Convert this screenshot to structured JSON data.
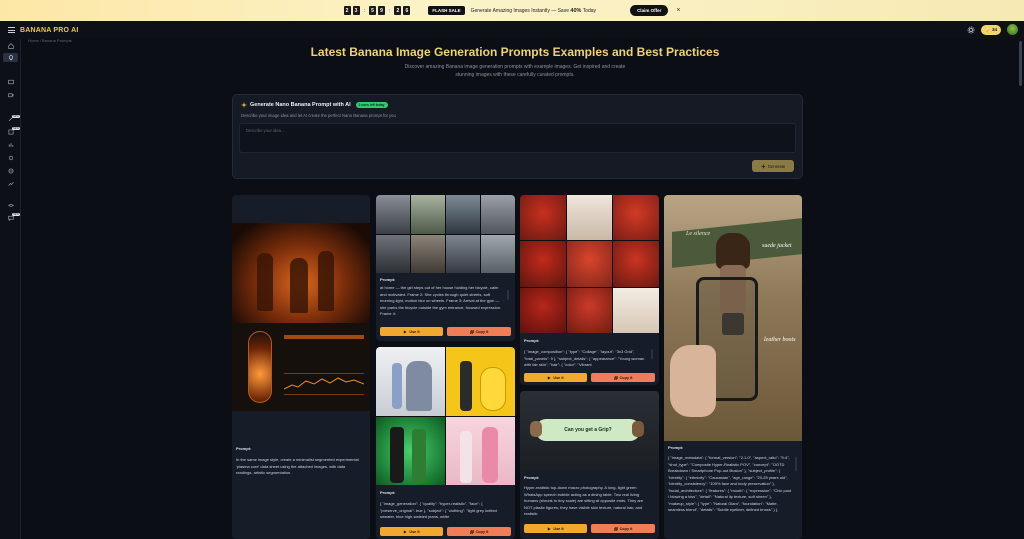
{
  "promo": {
    "timer": [
      "2",
      "3",
      "5",
      "9",
      "2",
      "6"
    ],
    "flash_label": "FLASH SALE",
    "text_pre": "Generate Amazing Images Instantly — Save",
    "text_pct": "40%",
    "text_post": "Today",
    "claim_label": "Claim Offer",
    "close": "×"
  },
  "header": {
    "brand": "BANANA PRO AI",
    "credits": "34"
  },
  "breadcrumb": "Home / Banana Prompts",
  "page": {
    "title": "Latest Banana Image Generation Prompts Examples and Best Practices",
    "subtitle": "Discover amazing Banana image generation prompts with example images. Get inspired and create stunning images with these carefully curated prompts."
  },
  "generator": {
    "title": "Generate Nano Banana Prompt with AI",
    "badge": "3 uses left today",
    "description": "Describe your image idea and let AI create the perfect Nano Banana prompt for you",
    "placeholder": "Describe your idea...",
    "button": "Generate"
  },
  "cards": [
    {
      "prompt_label": "Prompt:",
      "prompt": "In the same image style, create a minimalist segmented experimental 'plasma core' data sheet using the attached images, with data readings, artistic segmentation."
    },
    {
      "prompt_label": "Prompt:",
      "prompt": "at home — the girl steps out of her house holding her bicycle, calm and motivated. Frame 2: She cycles through quiet streets, soft morning light, motion blur on wheels. Frame 3: Arrival at the gym — she parks the bicycle outside the gym entrance, focused expression. Frame 4:",
      "use": "Use It",
      "copy": "Copy It"
    },
    {
      "prompt_label": "Prompt:",
      "prompt": "{ \"image_generation\": { \"quality\": \"hyper-realistic\", \"face\": { \"preserve_original\": true }, \"subject\": { \"clothing\": \"light grey knitted sweater, blue high-waisted jeans, white",
      "use": "Use It",
      "copy": "Copy It"
    },
    {
      "prompt_label": "Prompt:",
      "prompt": "{ \"image_composition\": { \"type\": \"Collage\", \"layout\": \"3x3 Grid\", \"total_panels\": 9 }, \"subject_details\": { \"appearance\": \"Young woman with fair skin\", \"hair\": { \"color\": \"Vibrant",
      "use": "Use It",
      "copy": "Copy It"
    },
    {
      "prompt_label": "Prompt:",
      "prompt": "Hyper-realistic top-down macro photography. A long, light green WhatsApp speech bubble acting as a dining table. Two real living humans (shrunk to tiny scale) are sitting at opposite ends. They are NOT plastic figures, they have visible skin texture, natural hair, and realistic",
      "bubble": "Can you get a Grip?",
      "use": "Use It",
      "copy": "Copy It"
    },
    {
      "prompt_label": "Prompt:",
      "prompt": "{ \"image_metadata\": { \"format_version\": \"2.1.0\", \"aspect_ratio\": \"9:4\", \"shot_type\": \"Composite Hyper-Realistic POV\", \"concept\": \"OOTD Breakdown / Smartphone Pop-out Illusion\" }, \"subject_profile\": { \"identity\": { \"ethnicity\": \"Caucasian\", \"age_range\": \"20-25 years old\", \"identity_consistency\": \"100% face and body preservation\" }, \"facial_architecture\": { \"features\": { \"mouth\": { \"expression\": \"Chic pout / blowing a kiss\", \"detail\": \"Natural lip texture, soft sheen\" }, \"makeup_style\": { \"type\": \"Natural Glam\", \"foundation\": \"Matte, seamless blend\", \"details\": \"Subtle eyeliner, defined brows\" } },",
      "annot1": "suede jacket",
      "annot2": "leather boots",
      "sign": "Le silence"
    }
  ],
  "sidebar": {
    "items": [
      "home-icon",
      "prompts-icon",
      "image-icon",
      "video-icon",
      "edit-icon",
      "new-icon",
      "chart-icon",
      "tools-icon",
      "globe-icon",
      "stats-icon",
      "layers-icon",
      "chat-icon"
    ],
    "badge_new": "NEW"
  }
}
